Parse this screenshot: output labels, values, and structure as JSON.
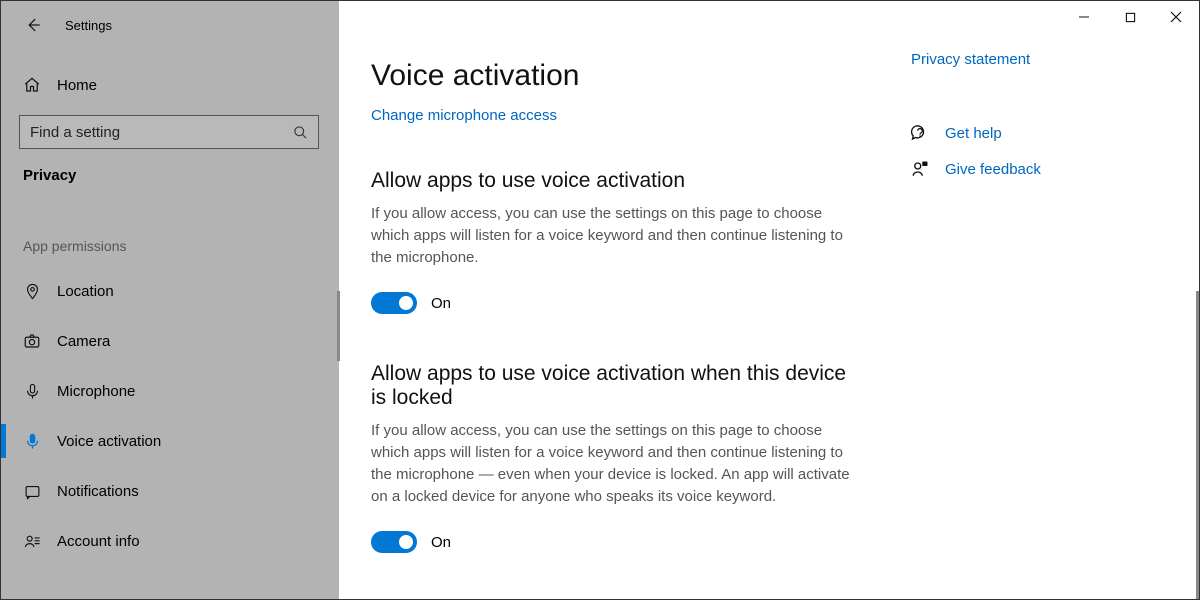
{
  "window": {
    "title": "Settings"
  },
  "sidebar": {
    "home": "Home",
    "search_placeholder": "Find a setting",
    "category": "Privacy",
    "section": "App permissions",
    "items": [
      {
        "label": "Location"
      },
      {
        "label": "Camera"
      },
      {
        "label": "Microphone"
      },
      {
        "label": "Voice activation"
      },
      {
        "label": "Notifications"
      },
      {
        "label": "Account info"
      }
    ]
  },
  "main": {
    "heading": "Voice activation",
    "mic_link": "Change microphone access",
    "section1": {
      "title": "Allow apps to use voice activation",
      "desc": "If you allow access, you can use the settings on this page to choose which apps will listen for a voice keyword and then continue listening to the microphone.",
      "toggle": "On"
    },
    "section2": {
      "title": "Allow apps to use voice activation when this device is locked",
      "desc": "If you allow access, you can use the settings on this page to choose which apps will listen for a voice keyword and then continue listening to the microphone — even when your device is locked. An app will activate on a locked device for anyone who speaks its voice keyword.",
      "toggle": "On"
    }
  },
  "aside": {
    "privacy": "Privacy statement",
    "help": "Get help",
    "feedback": "Give feedback"
  }
}
